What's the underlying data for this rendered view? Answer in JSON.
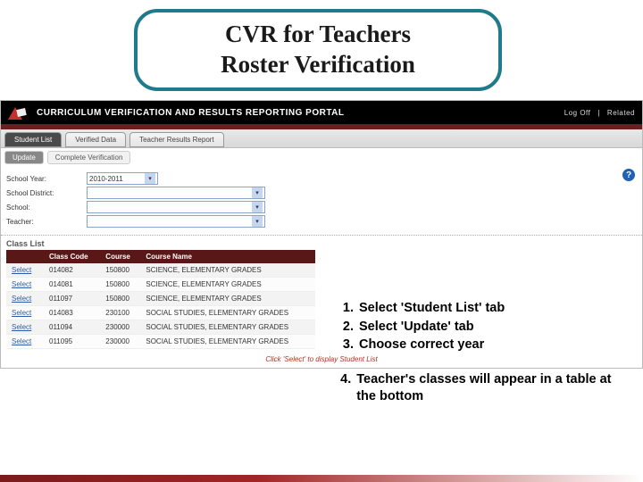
{
  "title": {
    "line1": "CVR for Teachers",
    "line2": "Roster Verification"
  },
  "portal": {
    "header_title": "CURRICULUM VERIFICATION AND RESULTS REPORTING PORTAL",
    "header_links": {
      "logoff": "Log Off",
      "related": "Related"
    },
    "tabs": {
      "student_list": "Student List",
      "verified_data": "Verified Data",
      "teacher_results": "Teacher Results Report"
    },
    "subtabs": {
      "update": "Update",
      "complete": "Complete Verification"
    },
    "filters": {
      "school_year_label": "School Year:",
      "school_year_value": "2010-2011",
      "school_district_label": "School District:",
      "school_label": "School:",
      "teacher_label": "Teacher:",
      "help": "?"
    },
    "class_list_heading": "Class List",
    "table": {
      "headers": {
        "blank": "",
        "class_code": "Class Code",
        "course": "Course",
        "course_name": "Course Name"
      },
      "select_label": "Select",
      "rows": [
        {
          "class_code": "014082",
          "course": "150800",
          "course_name": "SCIENCE, ELEMENTARY GRADES"
        },
        {
          "class_code": "014081",
          "course": "150800",
          "course_name": "SCIENCE, ELEMENTARY GRADES"
        },
        {
          "class_code": "011097",
          "course": "150800",
          "course_name": "SCIENCE, ELEMENTARY GRADES"
        },
        {
          "class_code": "014083",
          "course": "230100",
          "course_name": "SOCIAL STUDIES, ELEMENTARY GRADES"
        },
        {
          "class_code": "011094",
          "course": "230000",
          "course_name": "SOCIAL STUDIES, ELEMENTARY GRADES"
        },
        {
          "class_code": "011095",
          "course": "230000",
          "course_name": "SOCIAL STUDIES, ELEMENTARY GRADES"
        }
      ]
    },
    "footer_note": "Click 'Select' to display Student List"
  },
  "instructions": {
    "items": [
      {
        "n": "1.",
        "text": "Select 'Student List' tab"
      },
      {
        "n": "2.",
        "text": "Select 'Update' tab"
      },
      {
        "n": "3.",
        "text": "Choose correct year"
      }
    ],
    "item4": {
      "n": "4.",
      "text": "Teacher's classes will appear in a table at the bottom"
    }
  }
}
